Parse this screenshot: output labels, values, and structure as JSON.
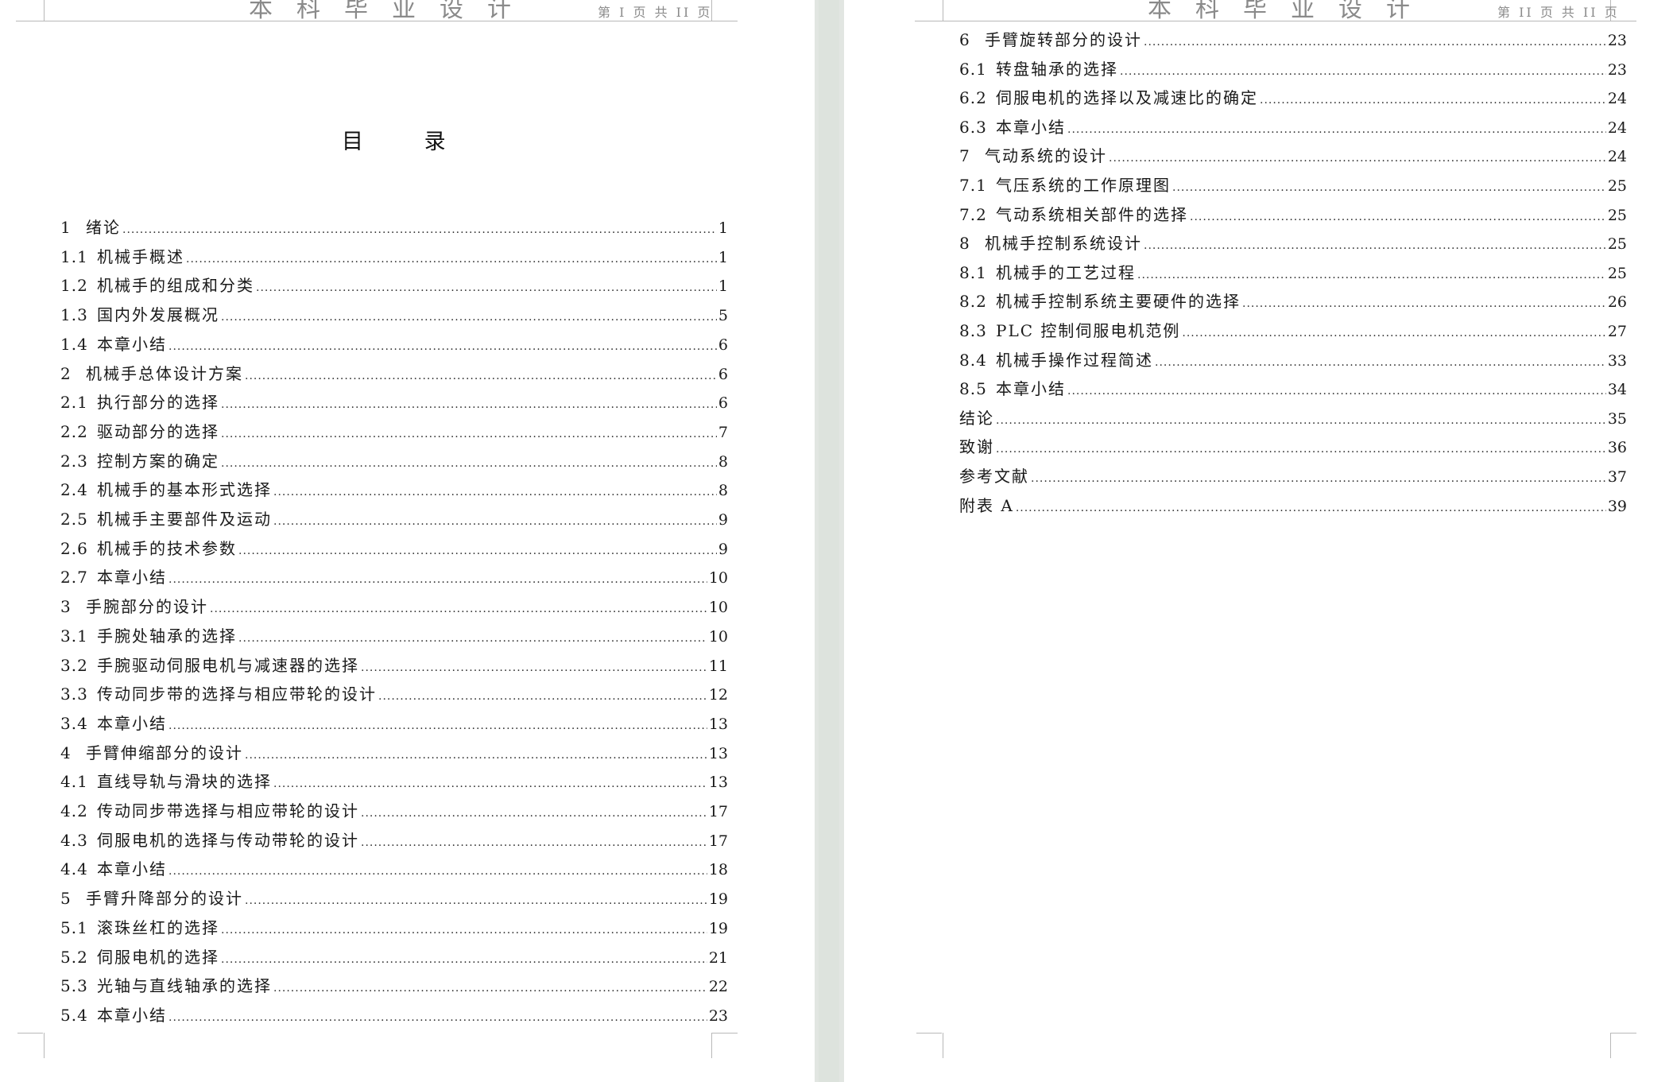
{
  "header": {
    "title": "本科毕业设计",
    "left_page_info": "第 I 页 共 II 页",
    "right_page_info": "第 II 页 共 II 页"
  },
  "toc_title": "目 录",
  "left_entries": [
    {
      "num": "1",
      "text": "绪论",
      "page": "1"
    },
    {
      "num": "1.1",
      "text": "机械手概述",
      "page": "1"
    },
    {
      "num": "1.2",
      "text": "机械手的组成和分类",
      "page": "1"
    },
    {
      "num": "1.3",
      "text": "国内外发展概况",
      "page": "5"
    },
    {
      "num": "1.4",
      "text": "本章小结",
      "page": "6"
    },
    {
      "num": "2",
      "text": "机械手总体设计方案",
      "page": "6"
    },
    {
      "num": "2.1",
      "text": "执行部分的选择",
      "page": "6"
    },
    {
      "num": "2.2",
      "text": "驱动部分的选择",
      "page": "7"
    },
    {
      "num": "2.3",
      "text": "控制方案的确定",
      "page": "8"
    },
    {
      "num": "2.4",
      "text": "机械手的基本形式选择",
      "page": "8"
    },
    {
      "num": "2.5",
      "text": "机械手主要部件及运动",
      "page": "9"
    },
    {
      "num": "2.6",
      "text": "机械手的技术参数",
      "page": "9"
    },
    {
      "num": "2.7",
      "text": "本章小结",
      "page": "10"
    },
    {
      "num": "3",
      "text": "手腕部分的设计",
      "page": "10"
    },
    {
      "num": "3.1",
      "text": "手腕处轴承的选择",
      "page": "10"
    },
    {
      "num": "3.2",
      "text": "手腕驱动伺服电机与减速器的选择",
      "page": "11"
    },
    {
      "num": "3.3",
      "text": "传动同步带的选择与相应带轮的设计",
      "page": "12"
    },
    {
      "num": "3.4",
      "text": "本章小结",
      "page": "13"
    },
    {
      "num": "4",
      "text": "手臂伸缩部分的设计",
      "page": "13"
    },
    {
      "num": "4.1",
      "text": "直线导轨与滑块的选择",
      "page": "13"
    },
    {
      "num": "4.2",
      "text": "传动同步带选择与相应带轮的设计",
      "page": "17"
    },
    {
      "num": "4.3",
      "text": "伺服电机的选择与传动带轮的设计",
      "page": "17"
    },
    {
      "num": "4.4",
      "text": "本章小结",
      "page": "18"
    },
    {
      "num": "5",
      "text": "手臂升降部分的设计",
      "page": "19"
    },
    {
      "num": "5.1",
      "text": "滚珠丝杠的选择",
      "page": "19"
    },
    {
      "num": "5.2",
      "text": "伺服电机的选择",
      "page": "21"
    },
    {
      "num": "5.3",
      "text": "光轴与直线轴承的选择",
      "page": "22"
    },
    {
      "num": "5.4",
      "text": "本章小结",
      "page": "23"
    }
  ],
  "right_entries": [
    {
      "num": "6",
      "text": "手臂旋转部分的设计",
      "page": "23"
    },
    {
      "num": "6.1",
      "text": "转盘轴承的选择",
      "page": "23"
    },
    {
      "num": "6.2",
      "text": "伺服电机的选择以及减速比的确定",
      "page": "24"
    },
    {
      "num": "6.3",
      "text": "本章小结",
      "page": "24"
    },
    {
      "num": "7",
      "text": "气动系统的设计",
      "page": "24"
    },
    {
      "num": "7.1",
      "text": "气压系统的工作原理图",
      "page": "25"
    },
    {
      "num": "7.2",
      "text": "气动系统相关部件的选择",
      "page": "25"
    },
    {
      "num": "8",
      "text": "机械手控制系统设计",
      "page": "25"
    },
    {
      "num": "8.1",
      "text": "机械手的工艺过程",
      "page": "25"
    },
    {
      "num": "8.2",
      "text": "机械手控制系统主要硬件的选择",
      "page": "26"
    },
    {
      "num": "8.3",
      "text": "PLC 控制伺服电机范例",
      "page": "27"
    },
    {
      "num": "8.4",
      "text": "机械手操作过程简述",
      "page": "33"
    },
    {
      "num": "8.5",
      "text": "本章小结",
      "page": "34"
    },
    {
      "num": "",
      "text": "结论",
      "page": "35"
    },
    {
      "num": "",
      "text": "致谢",
      "page": "36"
    },
    {
      "num": "",
      "text": "参考文献",
      "page": "37"
    },
    {
      "num": "",
      "text": "附表 A",
      "page": "39"
    }
  ]
}
